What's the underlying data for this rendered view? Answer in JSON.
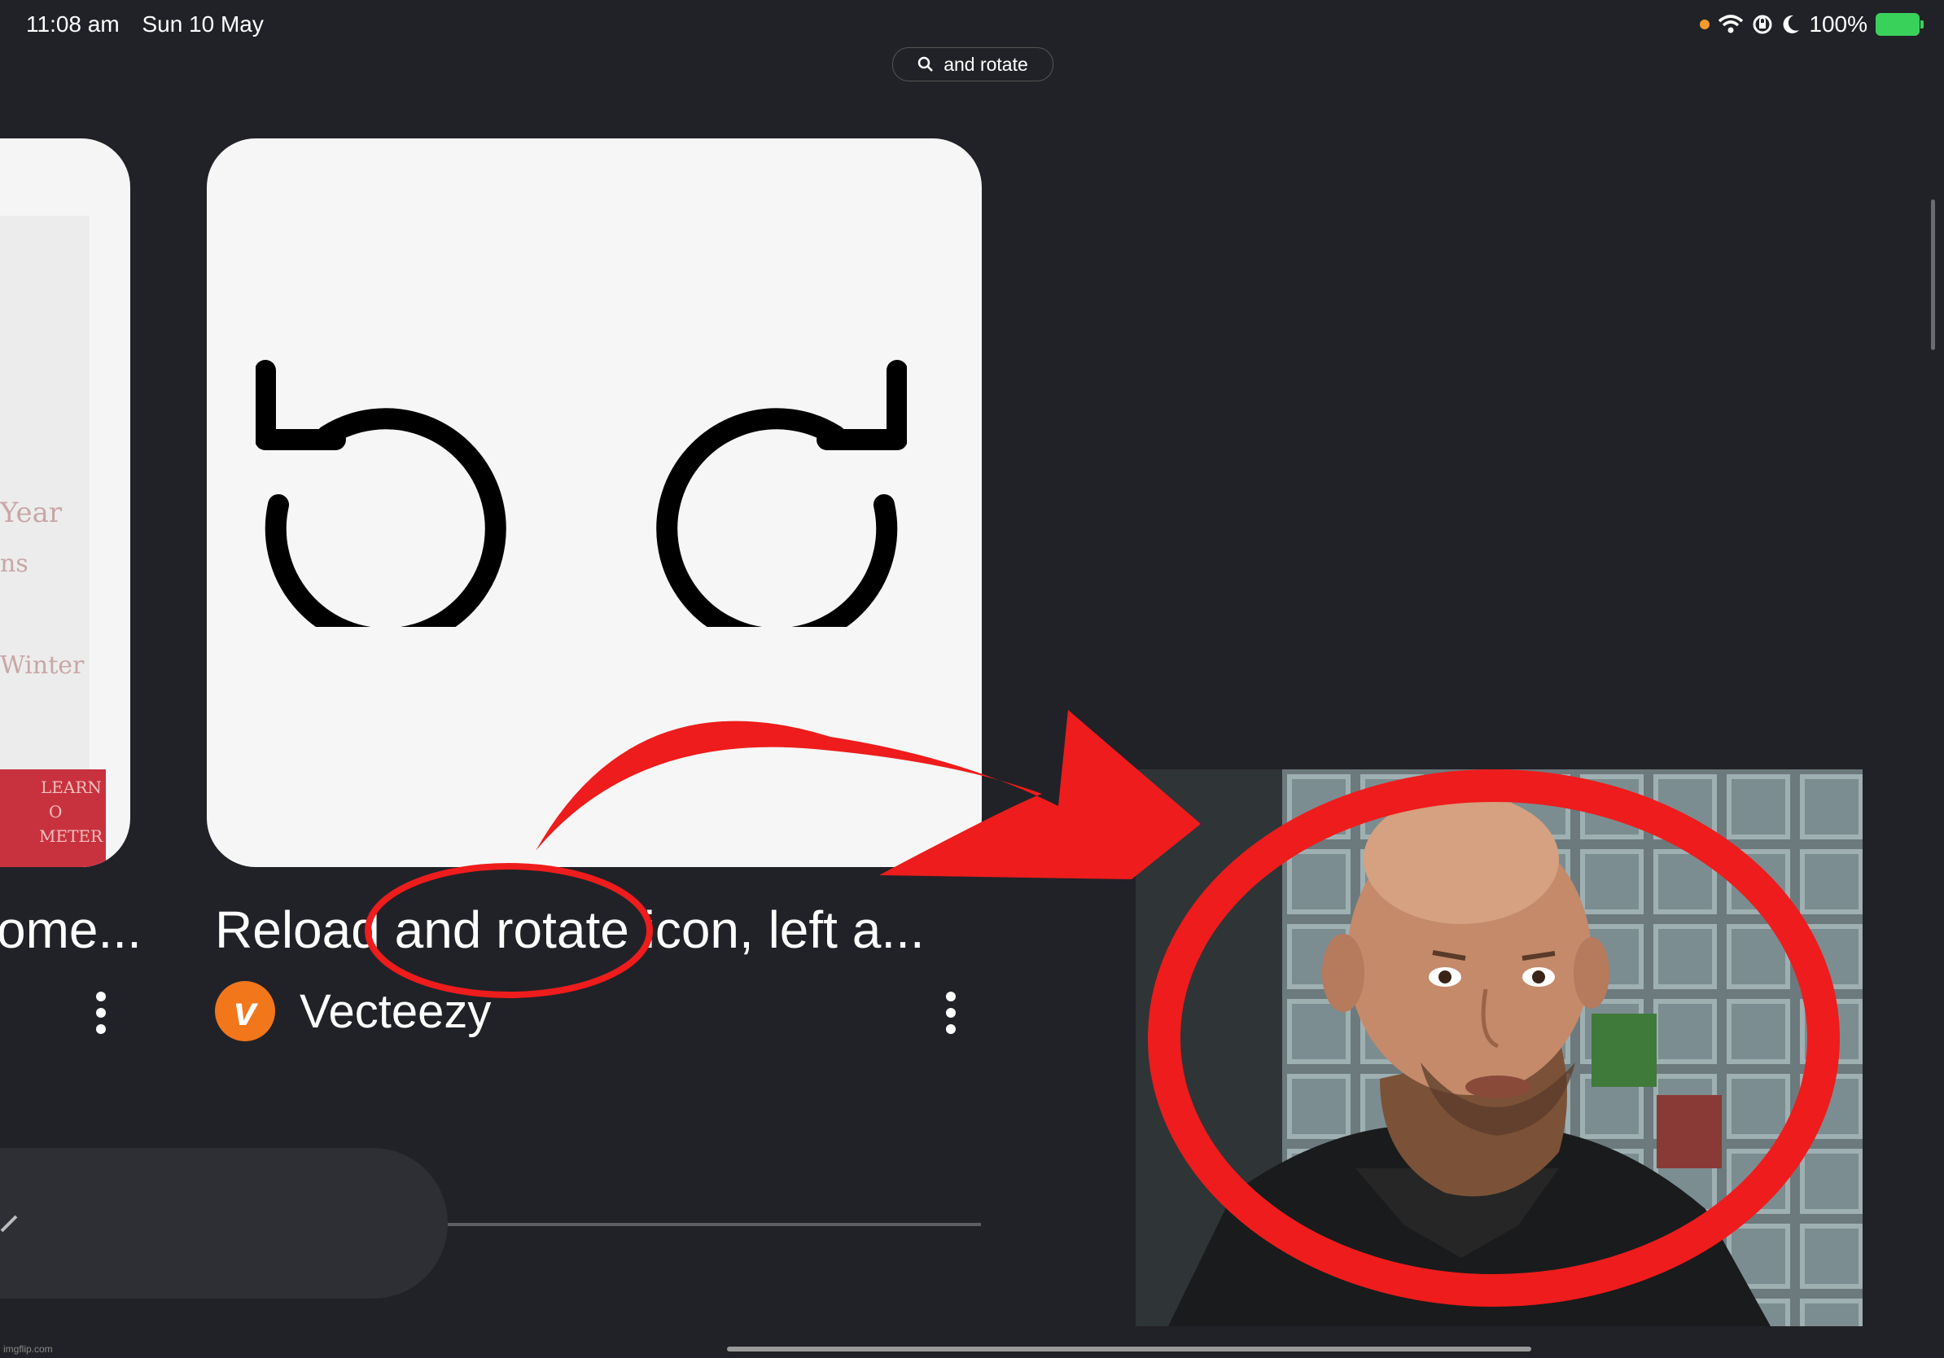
{
  "status_bar": {
    "time": "11:08 am",
    "date": "Sun 10 May",
    "battery": "100%"
  },
  "search": {
    "query": "and rotate"
  },
  "left_card": {
    "title_fragment": "ome...",
    "image_text": [
      "Year",
      "ns",
      "Winter",
      "LEARN",
      "O",
      "METER"
    ]
  },
  "main_card": {
    "title": "Reload and rotate icon, left a...",
    "source": "Vecteezy",
    "source_logo_letter": "v"
  },
  "watermark": "imgflip.com",
  "colors": {
    "background": "#212227",
    "annotation_red": "#ee1c1c",
    "source_logo": "#f2761a"
  },
  "icons": [
    "search-icon",
    "wifi-icon",
    "rotation-lock-icon",
    "moon-icon",
    "battery-icon",
    "rotate-left-icon",
    "rotate-right-icon",
    "more-vert-icon"
  ]
}
